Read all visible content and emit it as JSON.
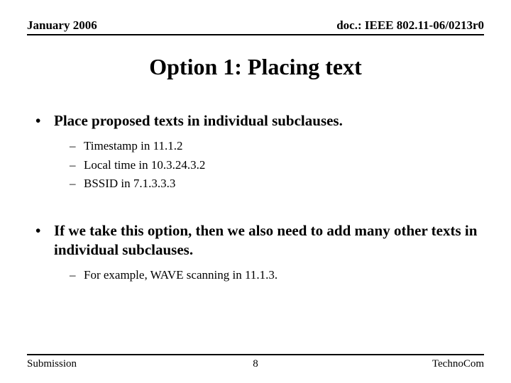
{
  "header": {
    "left": "January 2006",
    "right": "doc.: IEEE 802.11-06/0213r0"
  },
  "title": "Option 1: Placing text",
  "bullets": [
    {
      "text": "Place proposed texts in individual subclauses.",
      "subs": [
        "Timestamp in 11.1.2",
        "Local time in 10.3.24.3.2",
        "BSSID in 7.1.3.3.3"
      ]
    },
    {
      "text": "If we take this option, then we also need to add many other texts in individual subclauses.",
      "subs": [
        " For example, WAVE scanning in 11.1.3."
      ]
    }
  ],
  "footer": {
    "left": "Submission",
    "center": "8",
    "right": "TechnoCom"
  }
}
